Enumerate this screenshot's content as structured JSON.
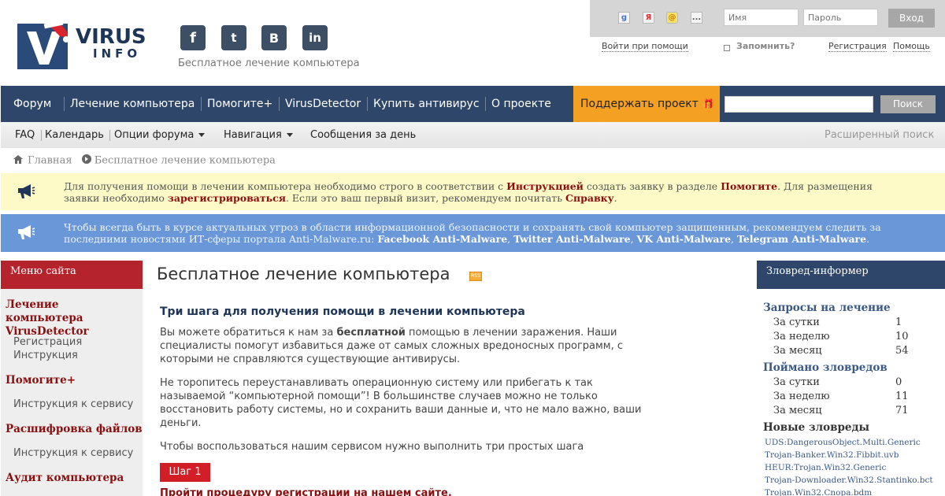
{
  "header": {
    "logo_line1": "VIRUS",
    "logo_line2": "INFO",
    "tagline": "Бесплатное лечение компьютера",
    "social": [
      {
        "icon": "facebook-icon",
        "glyph": "f"
      },
      {
        "icon": "twitter-icon",
        "glyph": "t"
      },
      {
        "icon": "vk-icon",
        "glyph": "B"
      },
      {
        "icon": "linkedin-icon",
        "glyph": "in"
      }
    ]
  },
  "login": {
    "external": [
      {
        "icon": "google-icon",
        "glyph": "g"
      },
      {
        "icon": "yandex-icon",
        "glyph": "Я"
      },
      {
        "icon": "mailru-icon",
        "glyph": "@"
      },
      {
        "icon": "more-icon",
        "glyph": "..."
      }
    ],
    "name_placeholder": "Имя",
    "password_placeholder": "Пароль",
    "submit_label": "Вход",
    "login_with_label": "Войти при помощи",
    "remember_label": "Запомнить?",
    "register_label": "Регистрация",
    "help_label": "Помощь"
  },
  "nav": {
    "items": [
      "Форум",
      "Лечение компьютера",
      "Помогите+",
      "VirusDetector",
      "Купить антивирус",
      "О проекте"
    ],
    "support_label": "Поддержать проект",
    "search_button": "Поиск"
  },
  "subnav": {
    "items": [
      "FAQ",
      "Календарь",
      "Опции форума",
      "Навигация",
      "Сообщения за день"
    ],
    "advanced_search": "Расширенный поиск"
  },
  "breadcrumb": {
    "home": "Главная",
    "current": "Бесплатное лечение компьютера"
  },
  "notices": {
    "n1": {
      "t1": "Для получения помощи в лечении компьютера необходимо строго в соответствии с ",
      "b1": "Инструкцией",
      "t2": " создать заявку в разделе ",
      "b2": "Помогите",
      "t3": ". Для размещения заявки необходимо ",
      "b3": "зарегистрироваться",
      "t4": ". Если это ваш первый визит, рекомендуем почитать ",
      "b4": "Справку",
      "t5": "."
    },
    "n2": {
      "t1": "Чтобы всегда быть в курсе актуальных угроз в области информационной безопасности и сохранять свой компьютер защищенным, рекомендуем следить за последними новостями ИТ-сферы портала Anti-Malware.ru: ",
      "b1": "Facebook Anti-Malware",
      "s1": ", ",
      "b2": "Twitter Anti-Malware",
      "s2": ", ",
      "b3": "VK Anti-Malware",
      "s3": ", ",
      "b4": "Telegram Anti-Malware",
      "t2": "."
    }
  },
  "sidebar": {
    "title": "Меню сайта",
    "sec1": "Лечение компьютера VirusDetector",
    "sec1_links": [
      "Регистрация",
      "Инструкция"
    ],
    "sec2": "Помогите+",
    "sec2_link": "Инструкция к сервису",
    "sec3": "Расшифровка файлов",
    "sec3_link": "Инструкция к сервису",
    "sec4": "Аудит компьютера"
  },
  "main": {
    "title": "Бесплатное лечение компьютера",
    "steps_heading": "Три шага для получения помощи в лечении компьютера",
    "para1_a": "Вы можете обратиться к нам за ",
    "para1_b": "бесплатной",
    "para1_c": " помощью в лечении заражения. Наши специалисты помогут избавиться даже от самых сложных вредоносных программ, с которыми не справляются существующие антивирусы.",
    "para2": "Не торопитесь переустанавливать операционную систему или прибегать к так называемой “компьютерной помощи”! В большинстве случаев можно не только восстановить работу системы, но и сохранить ваши данные и, что не мало важно, ваши деньги.",
    "para3": "Чтобы воспользоваться нашим сервисом нужно выполнить три простых шага",
    "step_label": "Шаг 1",
    "step_text": "Пройти процедуру регистрации на нашем сайте."
  },
  "informer": {
    "title": "Зловред-информер",
    "requests_heading": "Запросы на лечение",
    "requests": [
      {
        "label": "За сутки",
        "value": "1"
      },
      {
        "label": "За неделю",
        "value": "10"
      },
      {
        "label": "За месяц",
        "value": "54"
      }
    ],
    "caught_heading": "Поймано зловредов",
    "caught": [
      {
        "label": "За сутки",
        "value": "0"
      },
      {
        "label": "За неделю",
        "value": "11"
      },
      {
        "label": "За месяц",
        "value": "71"
      }
    ],
    "new_heading": "Новые зловреды",
    "new_list": [
      "UDS:DangerousObject.Multi.Generic",
      "Trojan-Banker.Win32.Fibbit.uvb",
      "HEUR:Trojan.Win32.Generic",
      "Trojan-Downloader.Win32.Stantinko.bct",
      "Trojan.Win32.Cnopa.bdm"
    ]
  }
}
